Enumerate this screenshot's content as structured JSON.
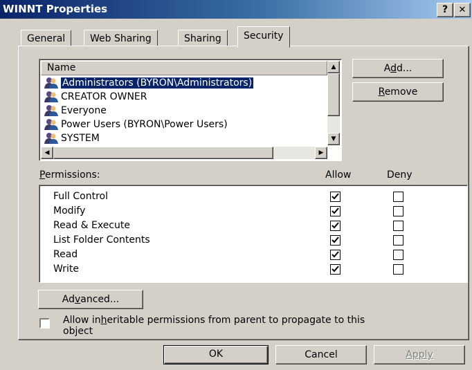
{
  "window": {
    "title": "WINNT Properties",
    "help_label": "?",
    "close_label": "✕"
  },
  "tabs": [
    {
      "label": "General"
    },
    {
      "label": "Web Sharing"
    },
    {
      "label": "Sharing"
    },
    {
      "label": "Security",
      "active": true
    }
  ],
  "names_list": {
    "header": "Name",
    "items": [
      {
        "label": "Administrators (BYRON\\Administrators)",
        "selected": true
      },
      {
        "label": "CREATOR OWNER"
      },
      {
        "label": "Everyone"
      },
      {
        "label": "Power Users (BYRON\\Power Users)"
      },
      {
        "label": "SYSTEM"
      }
    ]
  },
  "buttons": {
    "add": {
      "pre": "A",
      "mnemonic": "d",
      "post": "d..."
    },
    "remove": {
      "pre": "",
      "mnemonic": "R",
      "post": "emove"
    },
    "advanced": {
      "pre": "Ad",
      "mnemonic": "v",
      "post": "anced..."
    },
    "ok": "OK",
    "cancel": "Cancel",
    "apply": "Apply"
  },
  "permissions": {
    "label_mnemonic": "P",
    "label_rest": "ermissions:",
    "allow_header": "Allow",
    "deny_header": "Deny",
    "rows": [
      {
        "name": "Full Control",
        "allow": true,
        "deny": false
      },
      {
        "name": "Modify",
        "allow": true,
        "deny": false
      },
      {
        "name": "Read & Execute",
        "allow": true,
        "deny": false
      },
      {
        "name": "List Folder Contents",
        "allow": true,
        "deny": false
      },
      {
        "name": "Read",
        "allow": true,
        "deny": false
      },
      {
        "name": "Write",
        "allow": true,
        "deny": false
      }
    ]
  },
  "inherit": {
    "checked": false,
    "line1_pre": "Allow in",
    "line1_mnemonic": "h",
    "line1_post": "eritable permissions from parent to propagate to this",
    "line2": "object"
  },
  "colors": {
    "dialog_bg": "#d4d0c8",
    "selection": "#0a246a",
    "titlebar_start": "#0a246a"
  }
}
